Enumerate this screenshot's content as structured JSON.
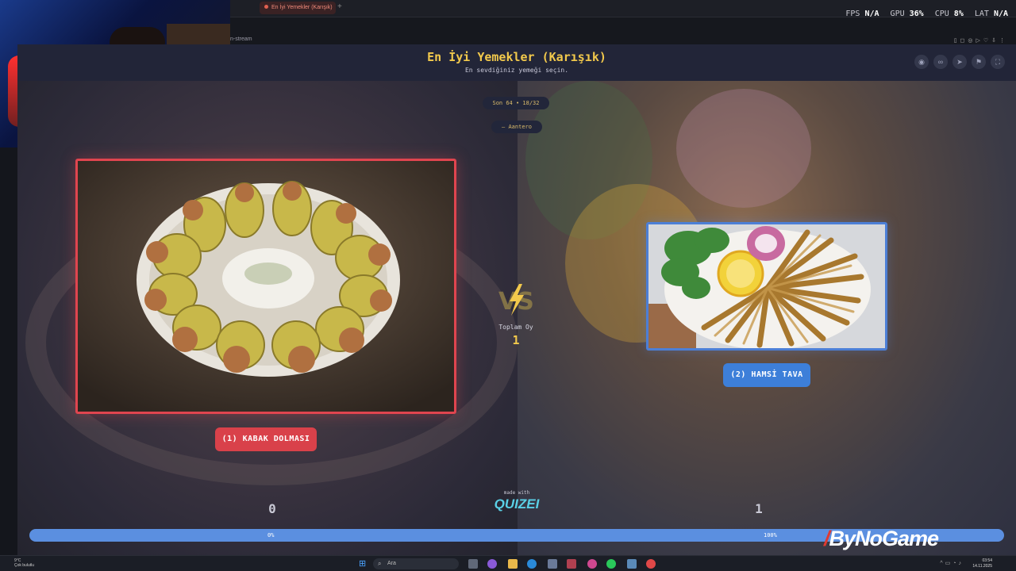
{
  "browser": {
    "tab_title": "En İyi Yemekler (Karışık)",
    "new_tab_symbol": "+",
    "url_fragment": "n-stream"
  },
  "overlay_stats": {
    "fps_label": "FPS",
    "fps_value": "N/A",
    "gpu_label": "GPU",
    "gpu_value": "36%",
    "cpu_label": "CPU",
    "cpu_value": "8%",
    "lat_label": "LAT",
    "lat_value": "N/A"
  },
  "page": {
    "title": "En İyi Yemekler (Karışık)",
    "subtitle": "En sevdiğiniz yemeği seçin.",
    "tool_icons": [
      "eye-icon",
      "link-icon",
      "send-icon",
      "flag-icon",
      "fullscreen-icon"
    ]
  },
  "match": {
    "round_label": "Son 64 • 18/32",
    "creator": "— Aantero",
    "total_votes_label": "Toplam Oy",
    "total_votes": "1"
  },
  "options": [
    {
      "label": "(1) KABAK DOLMASI",
      "votes": "0",
      "percent": "0%",
      "share": 0,
      "color": "#d9414a"
    },
    {
      "label": "(2) HAMSİ TAVA",
      "votes": "1",
      "percent": "100%",
      "share": 1,
      "color": "#3d7fd9"
    }
  ],
  "branding": {
    "made_with": "made with",
    "logo": "QUIZEI",
    "watermark": "ByNoGame"
  },
  "taskbar": {
    "weather_temp": "9°C",
    "weather_desc": "Çok bulutlu",
    "search_placeholder": "Ara",
    "time": "03:54",
    "date": "14.11.2025"
  }
}
